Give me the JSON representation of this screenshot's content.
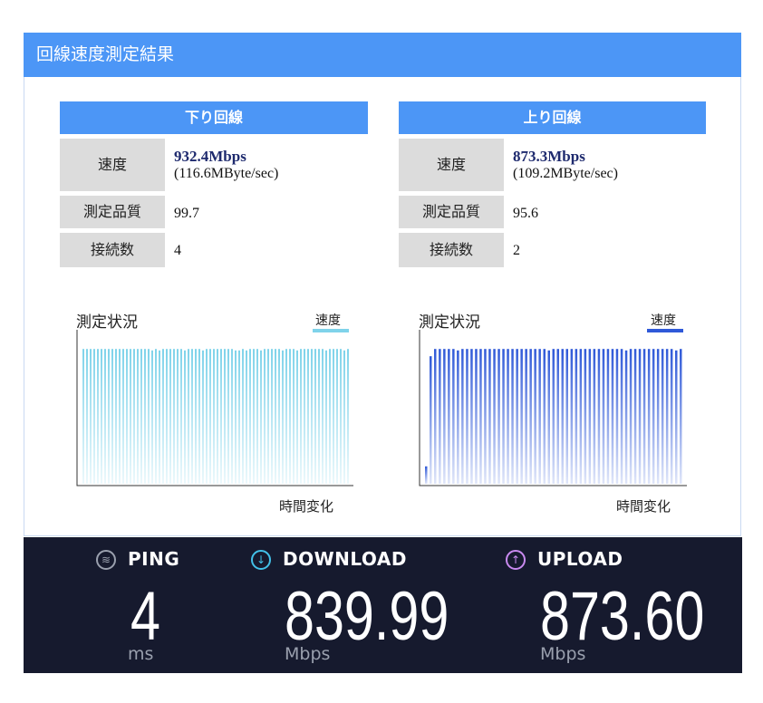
{
  "header": {
    "title": "回線速度測定結果"
  },
  "download": {
    "heading": "下り回線",
    "speed_label": "速度",
    "speed": "932.4Mbps",
    "speed_bytes": "(116.6MByte/sec)",
    "quality_label": "測定品質",
    "quality": "99.7",
    "conn_label": "接続数",
    "connections": "4",
    "chart_caption": "測定状況",
    "legend": "速度",
    "xlabel": "時間変化"
  },
  "upload": {
    "heading": "上り回線",
    "speed_label": "速度",
    "speed": "873.3Mbps",
    "speed_bytes": "(109.2MByte/sec)",
    "quality_label": "測定品質",
    "quality": "95.6",
    "conn_label": "接続数",
    "connections": "2",
    "chart_caption": "測定状況",
    "legend": "速度",
    "xlabel": "時間変化"
  },
  "metrics": {
    "ping": {
      "label": "PING",
      "value": "4",
      "unit": "ms",
      "icon": "ping-icon"
    },
    "download": {
      "label": "DOWNLOAD",
      "value": "839.99",
      "unit": "Mbps",
      "icon": "download-arrow-icon"
    },
    "upload": {
      "label": "UPLOAD",
      "value": "873.60",
      "unit": "Mbps",
      "icon": "upload-arrow-icon"
    }
  },
  "colors": {
    "header_blue": "#4c96f6",
    "download_bar": "#7fd3ea",
    "upload_bar": "#2f59d8",
    "dark_bg": "#161a2e",
    "download_icon": "#42c1e9",
    "upload_icon": "#c98af0"
  },
  "chart_data": [
    {
      "type": "bar",
      "series": [
        {
          "name": "速度",
          "values": [
            0.93,
            0.93,
            0.93,
            0.93,
            0.93,
            0.93,
            0.93,
            0.93,
            0.93,
            0.93,
            0.93,
            0.93,
            0.93,
            0.93,
            0.93,
            0.93,
            0.93,
            0.93,
            0.93,
            0.92,
            0.93,
            0.92,
            0.93,
            0.93,
            0.93,
            0.93,
            0.93,
            0.93,
            0.92,
            0.93,
            0.93,
            0.93,
            0.93,
            0.92,
            0.93,
            0.93,
            0.93,
            0.93,
            0.93,
            0.93,
            0.93,
            0.93,
            0.92,
            0.92,
            0.93,
            0.92,
            0.93,
            0.93,
            0.93,
            0.92,
            0.93,
            0.93,
            0.93,
            0.93,
            0.93,
            0.92,
            0.93,
            0.93,
            0.93,
            0.92,
            0.93,
            0.93,
            0.93,
            0.93,
            0.93,
            0.93,
            0.93,
            0.92,
            0.93,
            0.93,
            0.93,
            0.93,
            0.92,
            0.93
          ]
        }
      ],
      "xlabel": "時間変化",
      "ylim": [
        0,
        1
      ]
    },
    {
      "type": "bar",
      "series": [
        {
          "name": "速度",
          "values": [
            0.12,
            0.88,
            0.93,
            0.93,
            0.93,
            0.93,
            0.93,
            0.92,
            0.93,
            0.93,
            0.93,
            0.93,
            0.93,
            0.93,
            0.93,
            0.93,
            0.93,
            0.93,
            0.93,
            0.93,
            0.93,
            0.93,
            0.93,
            0.93,
            0.93,
            0.93,
            0.93,
            0.92,
            0.93,
            0.93,
            0.93,
            0.93,
            0.93,
            0.93,
            0.93,
            0.93,
            0.93,
            0.93,
            0.93,
            0.93,
            0.93,
            0.93,
            0.93,
            0.93,
            0.92,
            0.93,
            0.93,
            0.93,
            0.93,
            0.93,
            0.93,
            0.93,
            0.93,
            0.93,
            0.93,
            0.92,
            0.93
          ]
        }
      ],
      "xlabel": "時間変化",
      "ylim": [
        0,
        1
      ]
    }
  ]
}
